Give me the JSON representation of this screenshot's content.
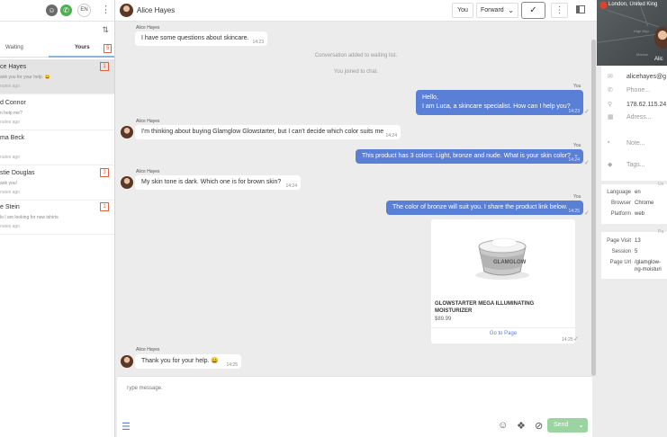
{
  "topbar": {
    "lang": "EN"
  },
  "sidebar": {
    "tabs": {
      "waiting": "Waiting",
      "yours": "Yours",
      "yours_count": "5"
    },
    "conversations": [
      {
        "name": "ce Hayes",
        "preview": "ank you for your help. 😀",
        "time": "nutes ago",
        "badge": "1",
        "active": true
      },
      {
        "name": "d Connor",
        "preview": "n help me?",
        "time": "nutes ago",
        "badge": "",
        "active": false
      },
      {
        "name": "ma Beck",
        "preview": "",
        "time": "nutes ago",
        "badge": "",
        "active": false
      },
      {
        "name": "stie Douglas",
        "preview": "ank you!",
        "time": "nutes ago",
        "badge": "3",
        "active": false
      },
      {
        "name": "e Stein",
        "preview": "lo I am looking for new tshirts",
        "time": "nutes ago",
        "badge": "1",
        "active": false
      }
    ]
  },
  "chat": {
    "contact_name": "Alice Hayes",
    "you_label": "You",
    "forward_label": "Forward",
    "messages": {
      "m1": {
        "author": "Alice Hayes",
        "text": "I have some questions about skincare.",
        "time": "14:23"
      },
      "sys1": "Conversation added to waiting list.",
      "sys2": "You joined to chat.",
      "m2": {
        "author": "You",
        "line1": "Hello,",
        "line2": "I am Luca, a skincare specialist. How can I help you?",
        "time": "14:23"
      },
      "m3": {
        "author": "Alice Hayes",
        "text": "I'm thinking about buying Glamglow Glowstarter, but I can't decide which color suits me",
        "time": "14:24"
      },
      "m4": {
        "author": "You",
        "text": "This product has 3 colors: Light, bronze and nude. What is your skin color?",
        "time": "14:24"
      },
      "m5": {
        "author": "Alice Hayes",
        "text": "My skin tone is dark. Which one is for brown skin?",
        "time": "14:24"
      },
      "m6": {
        "author": "You",
        "text": "The color of bronze will suit you. I share the product link below.",
        "time": "14:25"
      },
      "m7": {
        "author": "Alice Hayes",
        "text": "Thank you for your help. 😀",
        "time": "14:25"
      }
    },
    "product": {
      "brand": "GLAMGLOW",
      "title": "GLOWSTARTER MEGA ILLUMINATING MOISTURIZER",
      "price": "$89.99",
      "link": "Go to Page",
      "time": "14:25"
    },
    "composer": {
      "placeholder": "Type message.",
      "send_label": "Send"
    }
  },
  "visitor": {
    "location": "London, United King",
    "map_name": "Alic",
    "map_labels": [
      "High Wyc",
      "Marlow"
    ],
    "email": "alicehayes@g",
    "phone": "Phone...",
    "ip": "178.62.115.24",
    "address": "Adress...",
    "note": "Note...",
    "tags": "Tags...",
    "tech_header": "Us",
    "tech": [
      {
        "key": "Language",
        "value": "en"
      },
      {
        "key": "Browser",
        "value": "Chrome"
      },
      {
        "key": "Platform",
        "value": "web"
      }
    ],
    "visit_header": "Pa",
    "visit": [
      {
        "key": "Page Visit",
        "value": "13"
      },
      {
        "key": "Session",
        "value": "5"
      },
      {
        "key": "Page Url",
        "value": "/glamglow-",
        "value2": "ng-moisturi"
      }
    ]
  },
  "colors": {
    "outgoing_bubble": "#5a7fd6",
    "badge": "#e06040",
    "send": "#9bd4a1"
  }
}
